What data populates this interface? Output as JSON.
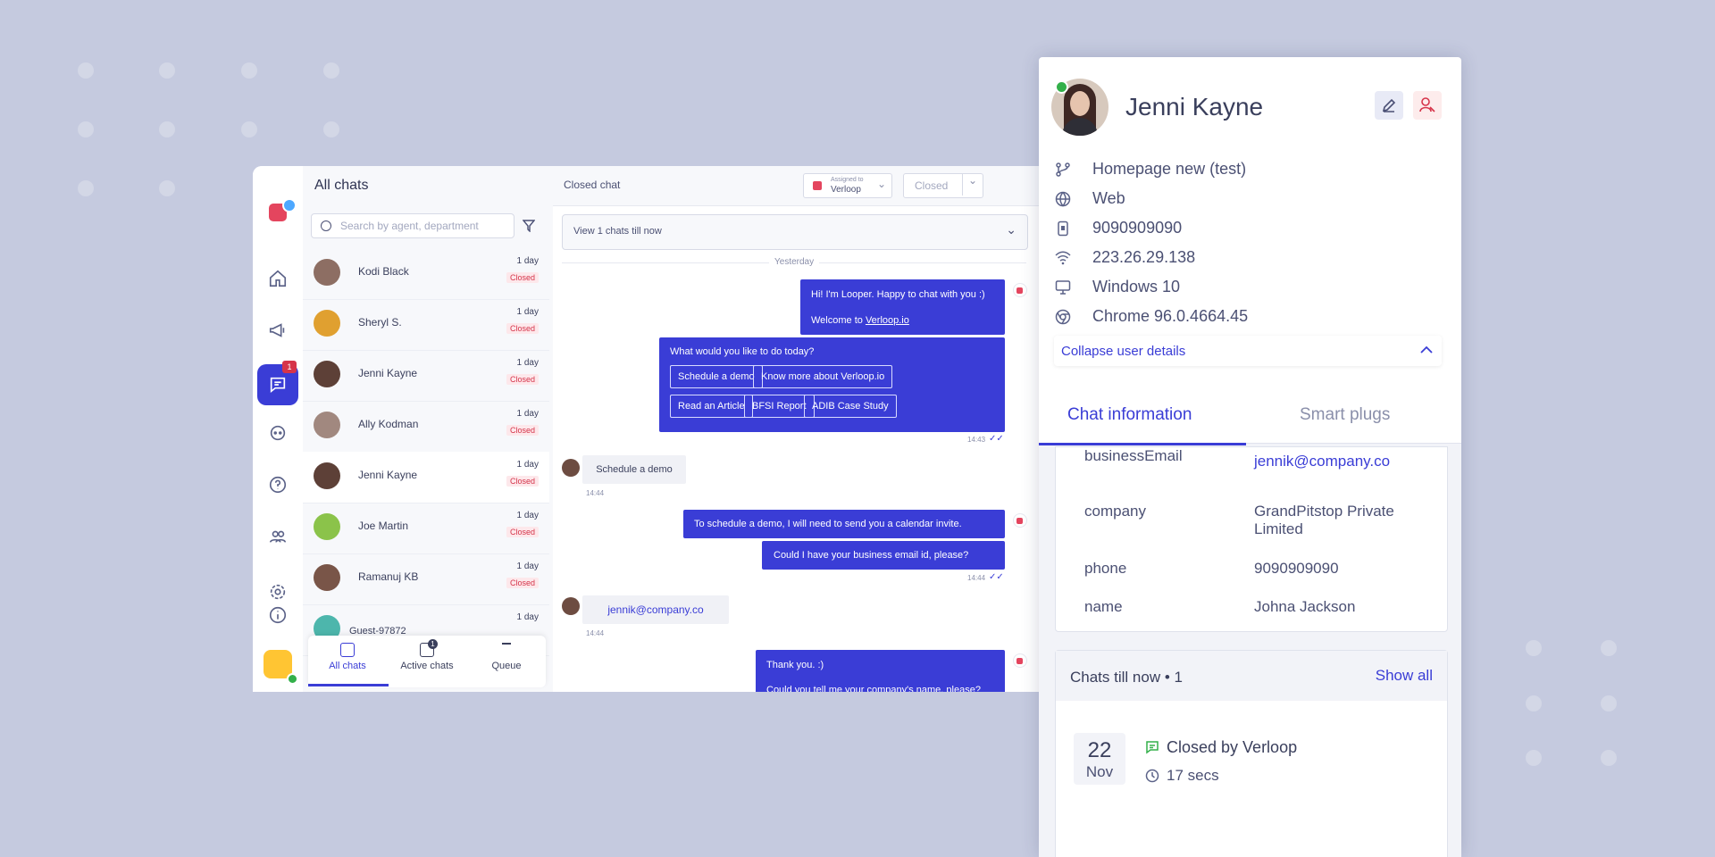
{
  "rail": {
    "chat_badge": "1"
  },
  "list": {
    "title": "All chats",
    "search_placeholder": "Search by agent, department",
    "rows": [
      {
        "name": "Kodi Black",
        "age": "1 day",
        "status": "Closed"
      },
      {
        "name": "Sheryl S.",
        "age": "1 day",
        "status": "Closed"
      },
      {
        "name": "Jenni Kayne",
        "age": "1 day",
        "status": "Closed"
      },
      {
        "name": "Ally Kodman",
        "age": "1 day",
        "status": "Closed"
      },
      {
        "name": "Jenni Kayne",
        "age": "1 day",
        "status": "Closed"
      },
      {
        "name": "Joe Martin",
        "age": "1 day",
        "status": "Closed"
      },
      {
        "name": "Ramanuj KB",
        "age": "1 day",
        "status": "Closed"
      },
      {
        "name": "Guest-97872",
        "age": "1 day",
        "status": ""
      }
    ],
    "tabs": {
      "all": "All chats",
      "active": "Active chats",
      "active_badge": "1",
      "queue": "Queue"
    }
  },
  "chat": {
    "title": "Closed chat",
    "assigned_label": "Assigned to",
    "assigned_value": "Verloop",
    "status_select": "Closed",
    "view_bar": "View 1 chats till now",
    "day": "Yesterday",
    "bot1_line1": "Hi! I'm Looper. Happy to chat with you :)",
    "bot1_line2_prefix": "Welcome to ",
    "bot1_link": "Verloop.io",
    "bot2_question": "What would you like to do today?",
    "options": [
      "Schedule a demo",
      "Know more about Verloop.io",
      "Read an Article",
      "BFSI Report",
      "ADIB Case Study"
    ],
    "t1": "14:43",
    "user1": "Schedule a demo",
    "t2": "14:44",
    "bot3": "To schedule a demo, I will need to send you a calendar invite.",
    "bot4": "Could I have your business email id, please?",
    "t3": "14:44",
    "user2": "jennik@company.co",
    "t4": "14:44",
    "bot5": "Thank you. :)",
    "bot6": "Could you tell me your company's name, please?"
  },
  "panel": {
    "name": "Jenni Kayne",
    "source": "Homepage new (test)",
    "channel": "Web",
    "phone": "9090909090",
    "ip": "223.26.29.138",
    "os": "Windows 10",
    "browser": "Chrome 96.0.4664.45",
    "collapse": "Collapse user details",
    "tab_info": "Chat information",
    "tab_plugs": "Smart plugs",
    "fields": [
      {
        "key": "businessEmail",
        "value": "jennik@company.co"
      },
      {
        "key": "company",
        "value": "GrandPitstop Private Limited"
      },
      {
        "key": "phone",
        "value": "9090909090"
      },
      {
        "key": "name",
        "value": "Johna Jackson"
      }
    ],
    "chats_title": "Chats till now • 1",
    "show_all": "Show all",
    "date_day": "22",
    "date_month": "Nov",
    "closed_by": "Closed by Verloop",
    "duration": "17 secs"
  }
}
